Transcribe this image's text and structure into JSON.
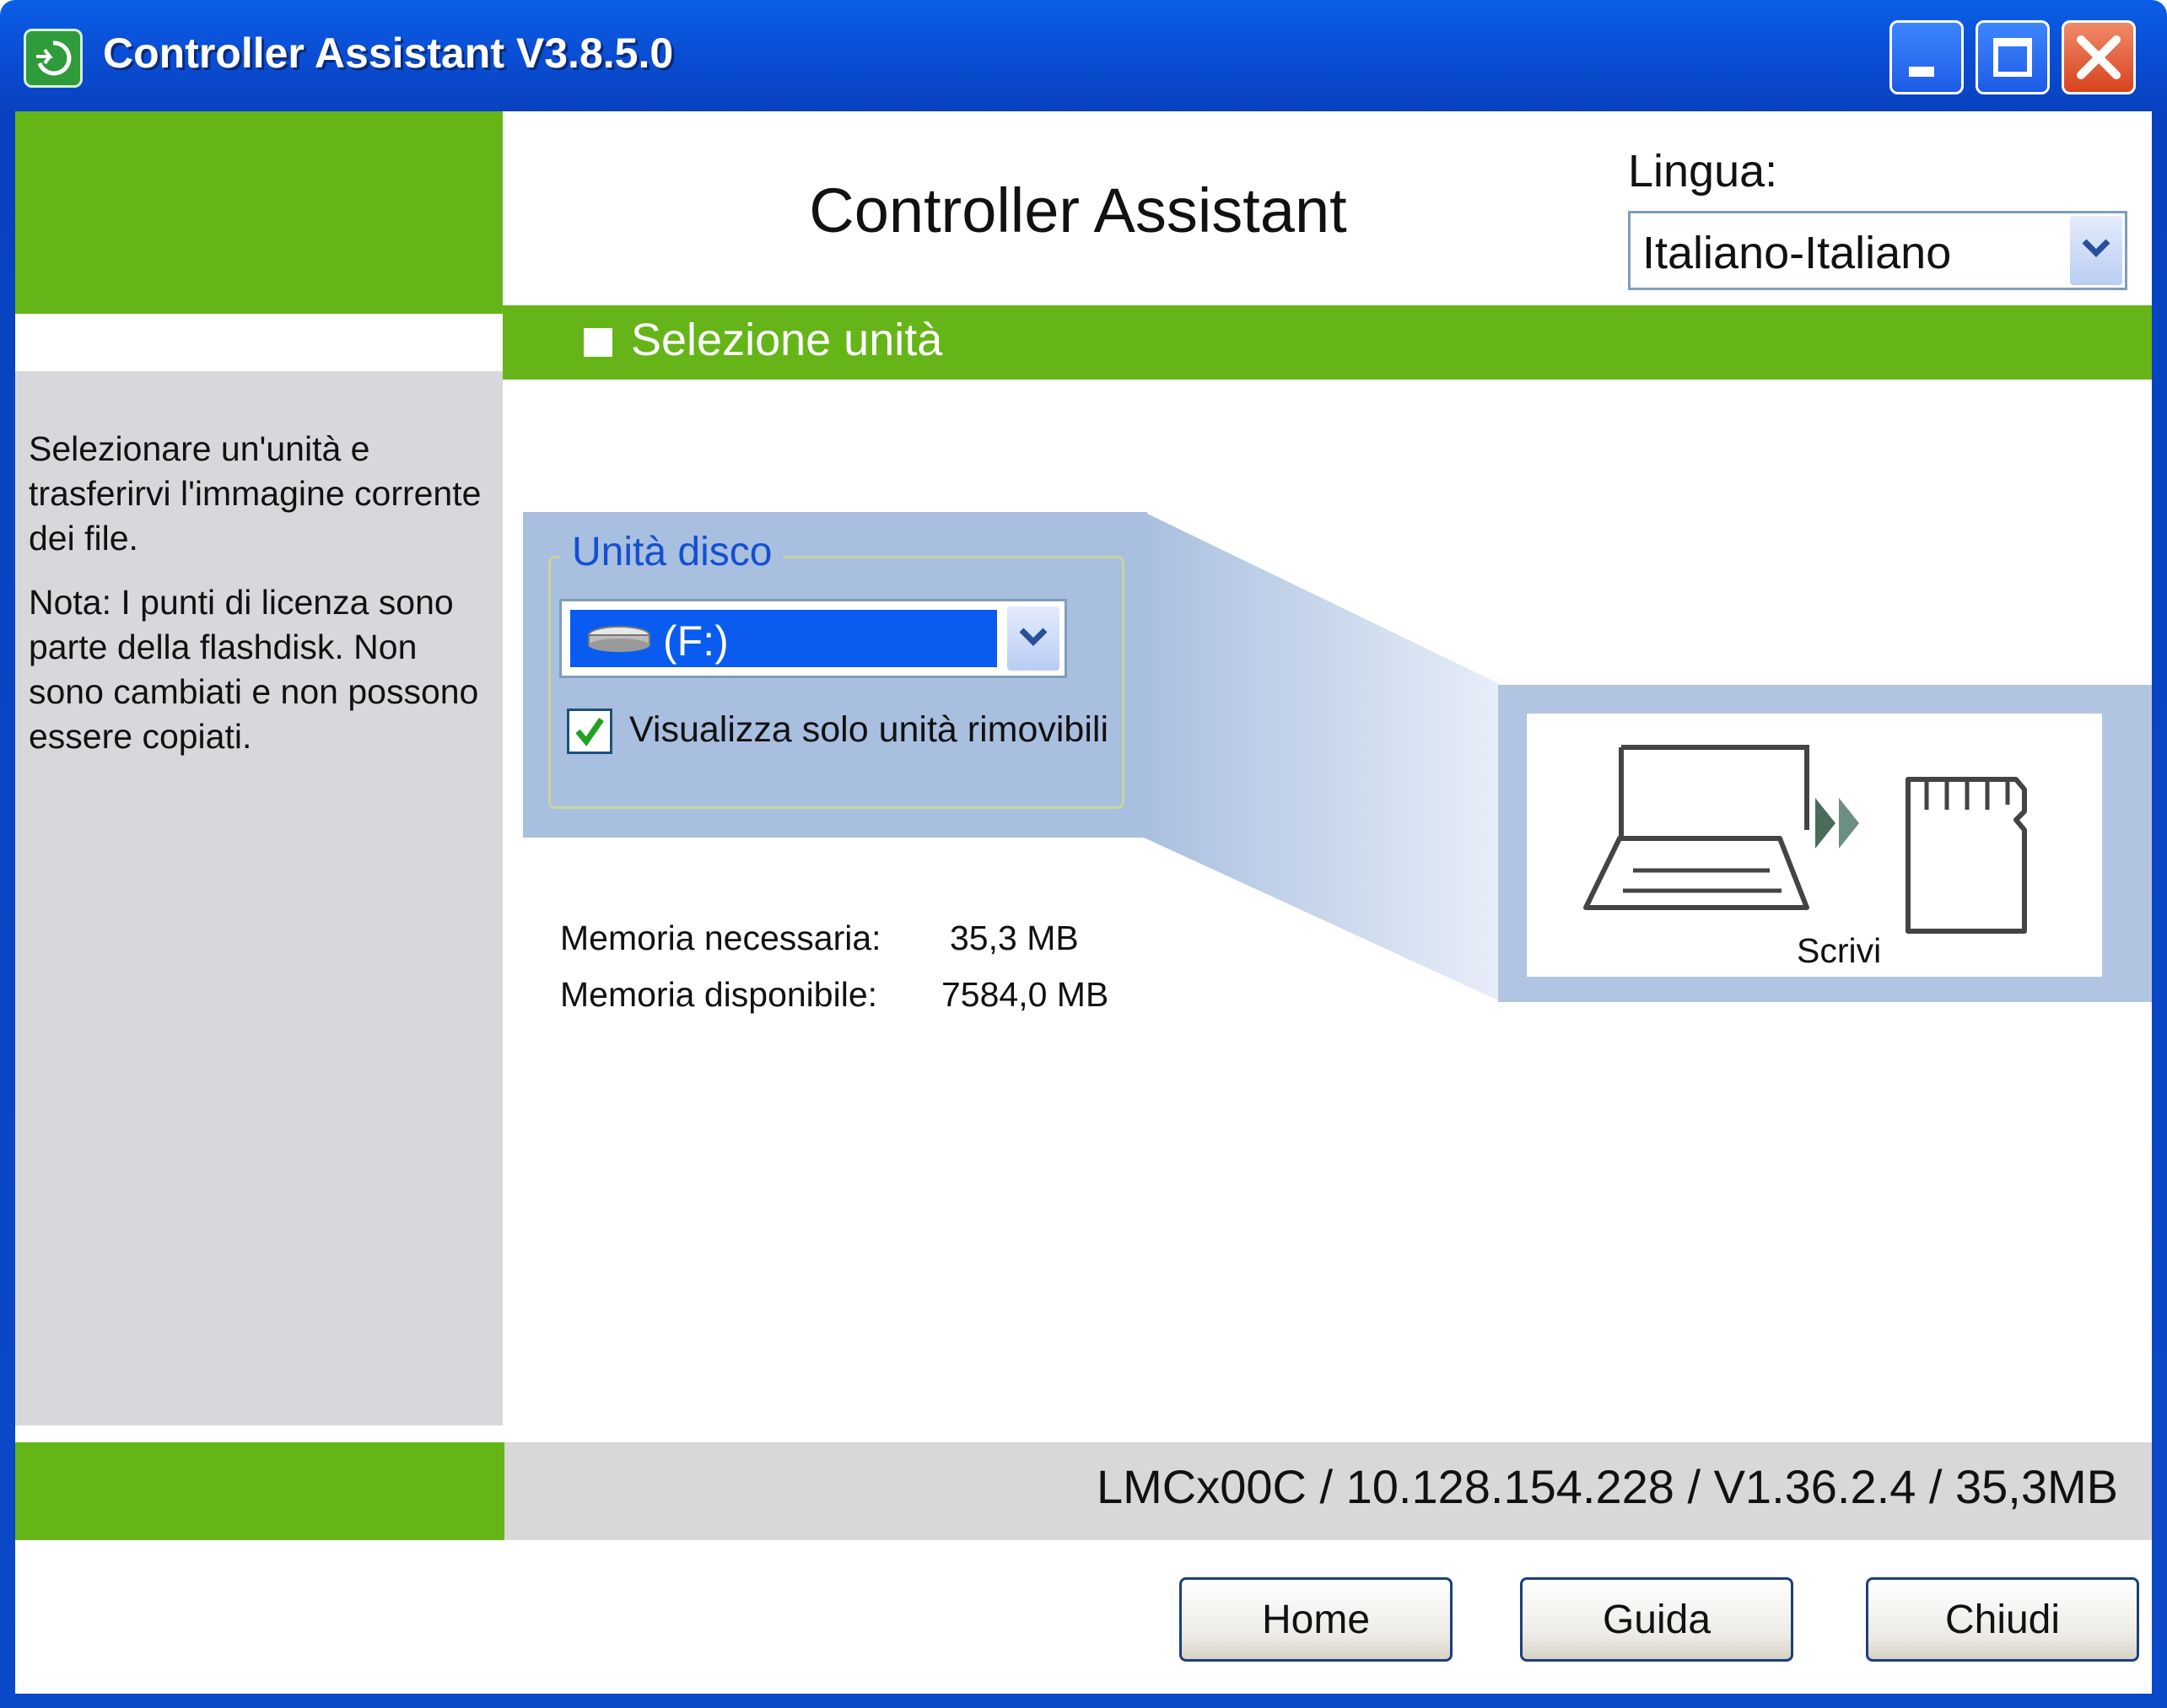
{
  "window": {
    "title": "Controller Assistant V3.8.5.0"
  },
  "header": {
    "app_title": "Controller Assistant",
    "language_label": "Lingua:",
    "language_value": "Italiano-Italiano"
  },
  "section": {
    "title": "Selezione unità"
  },
  "sidebar": {
    "paragraphs": [
      "Selezionare un'unità e trasferirvi l'immagine corrente dei file.",
      "Nota: I punti di licenza sono parte della flashdisk. Non sono cambiati e non possono essere copiati."
    ]
  },
  "drive": {
    "group_label": "Unità disco",
    "selected": "(F:)",
    "checkbox_label": "Visualizza solo unità rimovibili",
    "checkbox_checked": true
  },
  "write": {
    "label": "Scrivi"
  },
  "memory": {
    "required_label": "Memoria necessaria:",
    "required_value": "35,3 MB",
    "available_label": "Memoria disponibile:",
    "available_value": "7584,0 MB"
  },
  "status": {
    "text": "LMCx00C / 10.128.154.228 / V1.36.2.4 / 35,3MB"
  },
  "buttons": {
    "home": "Home",
    "help": "Guida",
    "close": "Chiudi"
  },
  "icons": [
    "app-icon",
    "minimize-icon",
    "maximize-icon",
    "close-icon",
    "chevron-down-icon",
    "drive-icon",
    "checkmark-icon",
    "laptop-icon",
    "forward-arrows-icon",
    "sd-card-icon"
  ],
  "colors": {
    "accent_green": "#65b519",
    "title_blue": "#0a4fd6",
    "selection_blue": "#0a5cf0",
    "panel_blue": "#a9bfe0"
  }
}
